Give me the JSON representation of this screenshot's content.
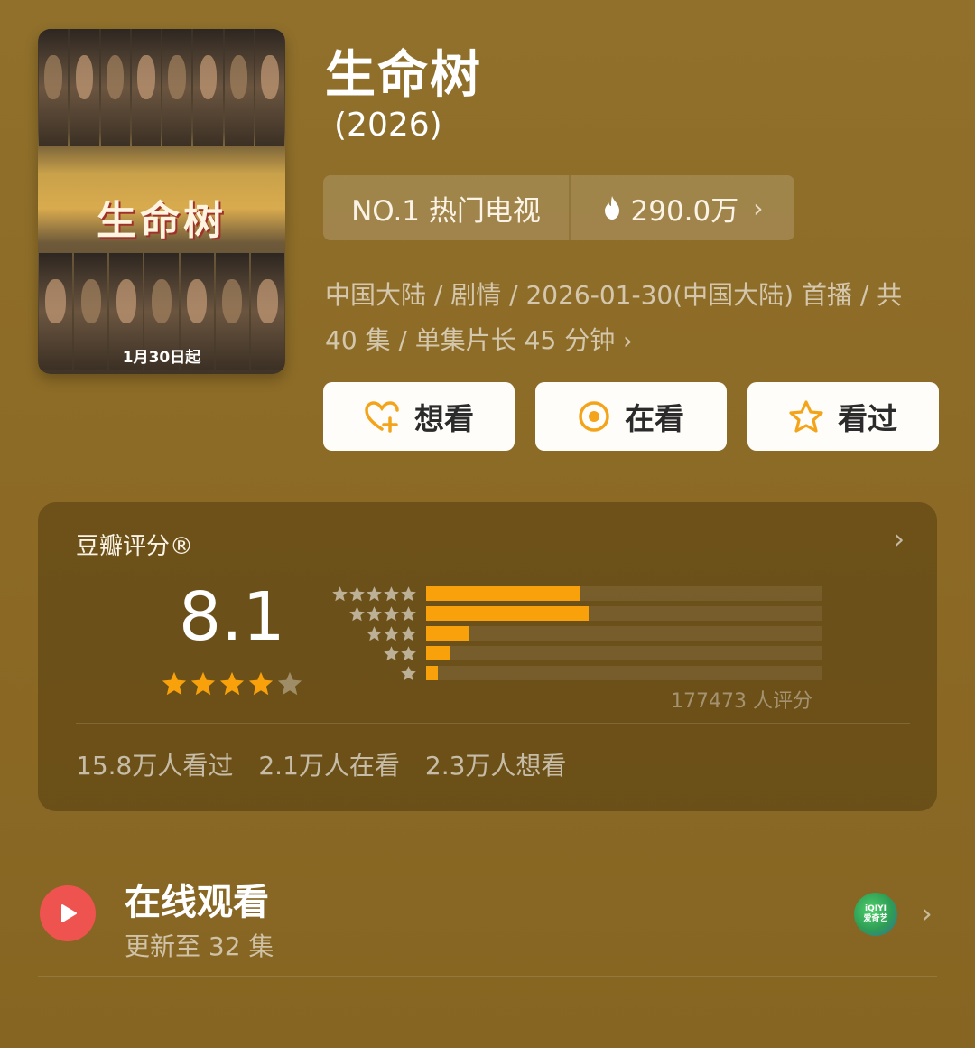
{
  "poster": {
    "title_art": "生命树",
    "air_date": "1月30日起"
  },
  "header": {
    "title": "生命树",
    "year": "(2026)"
  },
  "rank": {
    "label": "NO.1 热门电视",
    "heat": "290.0万"
  },
  "meta": {
    "line1": "中国大陆 / 剧情 / 2026-01-30(中国大陆) 首播 / 共",
    "line2": "40 集 / 单集片长 45 分钟"
  },
  "actions": [
    {
      "label": "想看",
      "icon": "heart-plus-icon"
    },
    {
      "label": "在看",
      "icon": "target-icon"
    },
    {
      "label": "看过",
      "icon": "star-outline-icon"
    }
  ],
  "rating": {
    "title": "豆瓣评分®",
    "score": "8.1",
    "stars_filled": 4,
    "stars_total": 5,
    "votes": "177473 人评分",
    "distribution": [
      {
        "stars": 5,
        "fraction": 0.39
      },
      {
        "stars": 4,
        "fraction": 0.41
      },
      {
        "stars": 3,
        "fraction": 0.11
      },
      {
        "stars": 2,
        "fraction": 0.06
      },
      {
        "stars": 1,
        "fraction": 0.03
      }
    ],
    "stats": {
      "watched": "15.8万人看过",
      "watching": "2.1万人在看",
      "want": "2.3万人想看"
    }
  },
  "watch": {
    "title": "在线观看",
    "subtitle": "更新至 32 集",
    "platform": "iQIYI\n爱奇艺"
  },
  "colors": {
    "accent": "#f8a10a",
    "background": "#8d6a26",
    "play": "#ef5350"
  }
}
